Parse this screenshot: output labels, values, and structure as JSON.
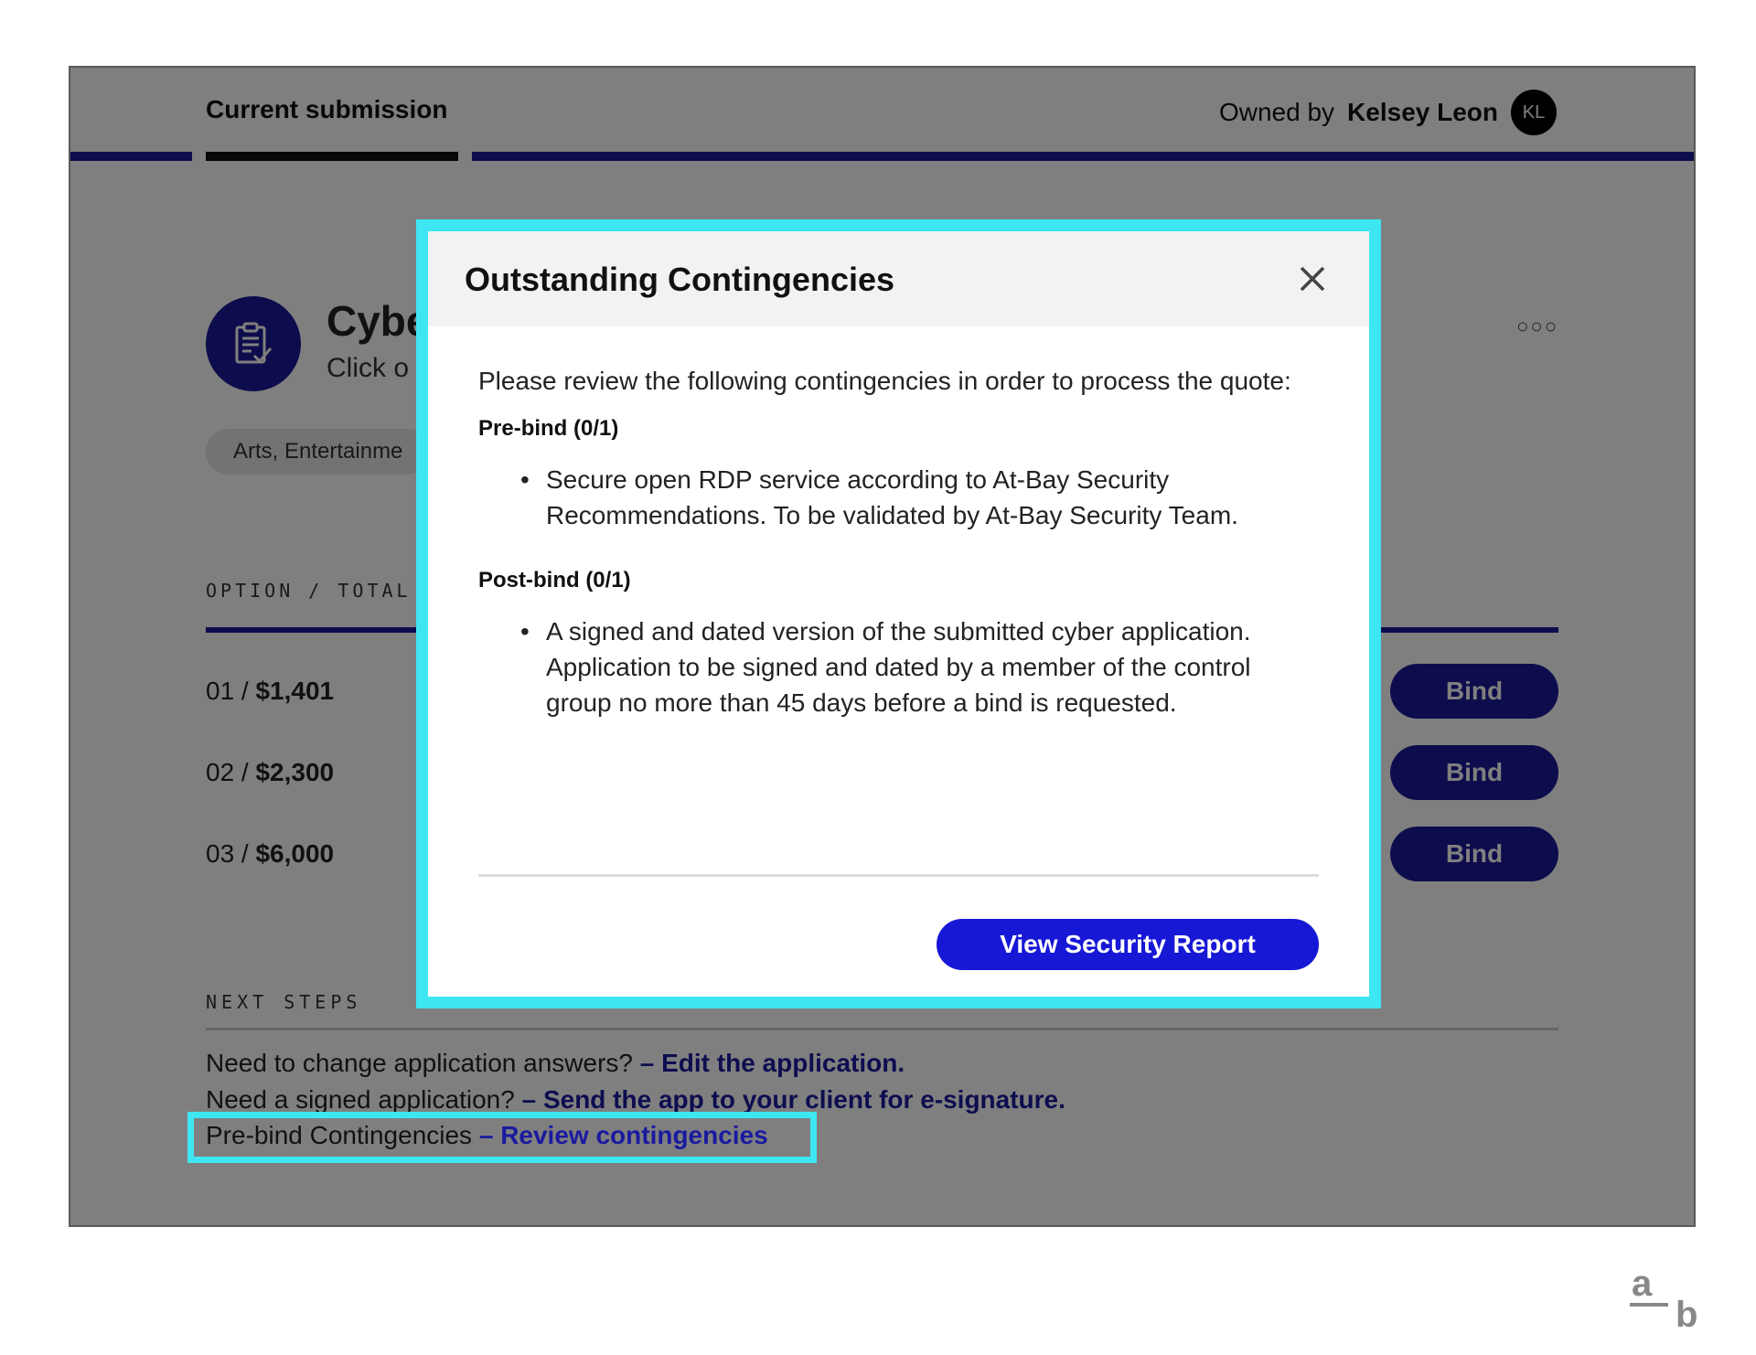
{
  "header": {
    "tab_label": "Current submission",
    "owner_prefix": "Owned by",
    "owner_name": "Kelsey Leon",
    "owner_initials": "KL"
  },
  "policy": {
    "title": "Cybe",
    "subtitle": "Click o",
    "industry": "Arts, Entertainme",
    "more_icon": "more-horizontal-icon"
  },
  "options": {
    "label": "OPTION / TOTAL",
    "rows": [
      {
        "num": "01 / ",
        "amount": "$1,401",
        "bind_label": "Bind"
      },
      {
        "num": "02 / ",
        "amount": "$2,300",
        "bind_label": "Bind"
      },
      {
        "num": "03 / ",
        "amount": "$6,000",
        "bind_label": "Bind"
      }
    ]
  },
  "next_steps": {
    "label": "NEXT STEPS",
    "lines": [
      {
        "text": "Need to change application answers?",
        "link": "– Edit the application."
      },
      {
        "text": "Need a signed application?",
        "link": "– Send the app to your client for e-signature."
      },
      {
        "text": "Pre-bind Contingencies",
        "link": "– Review contingencies"
      }
    ]
  },
  "modal": {
    "title": "Outstanding Contingencies",
    "intro": "Please review the following contingencies in order to process the quote:",
    "prebind_heading": "Pre-bind (0/1)",
    "prebind_items": [
      "Secure open RDP service according to At-Bay Security Recommendations. To be validated by At-Bay Security Team."
    ],
    "postbind_heading": "Post-bind (0/1)",
    "postbind_items": [
      "A signed and dated version of the submitted cyber application. Application to be signed and dated by a member of the control group no more than 45 days before a bind is requested."
    ],
    "report_button": "View Security Report"
  },
  "logo": {
    "top": "a",
    "bottom": "b"
  },
  "colors": {
    "brand_blue": "#1a1a9a",
    "button_blue": "#1717d6",
    "highlight_cyan": "#3ee6f2"
  }
}
